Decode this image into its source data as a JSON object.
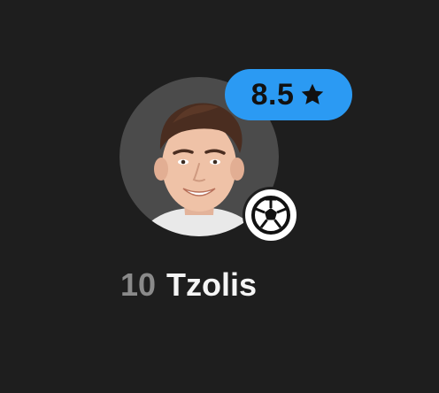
{
  "player": {
    "number": "10",
    "name": "Tzolis",
    "rating": "8.5",
    "rating_icon": "star-icon",
    "event_icon": "football-icon",
    "avatar_icon": "player-photo"
  },
  "colors": {
    "background": "#1e1e1e",
    "rating_badge": "#2b9af3",
    "avatar_ring": "#4b4b4b",
    "number_text": "#8a8a8a",
    "name_text": "#f5f5f5"
  }
}
